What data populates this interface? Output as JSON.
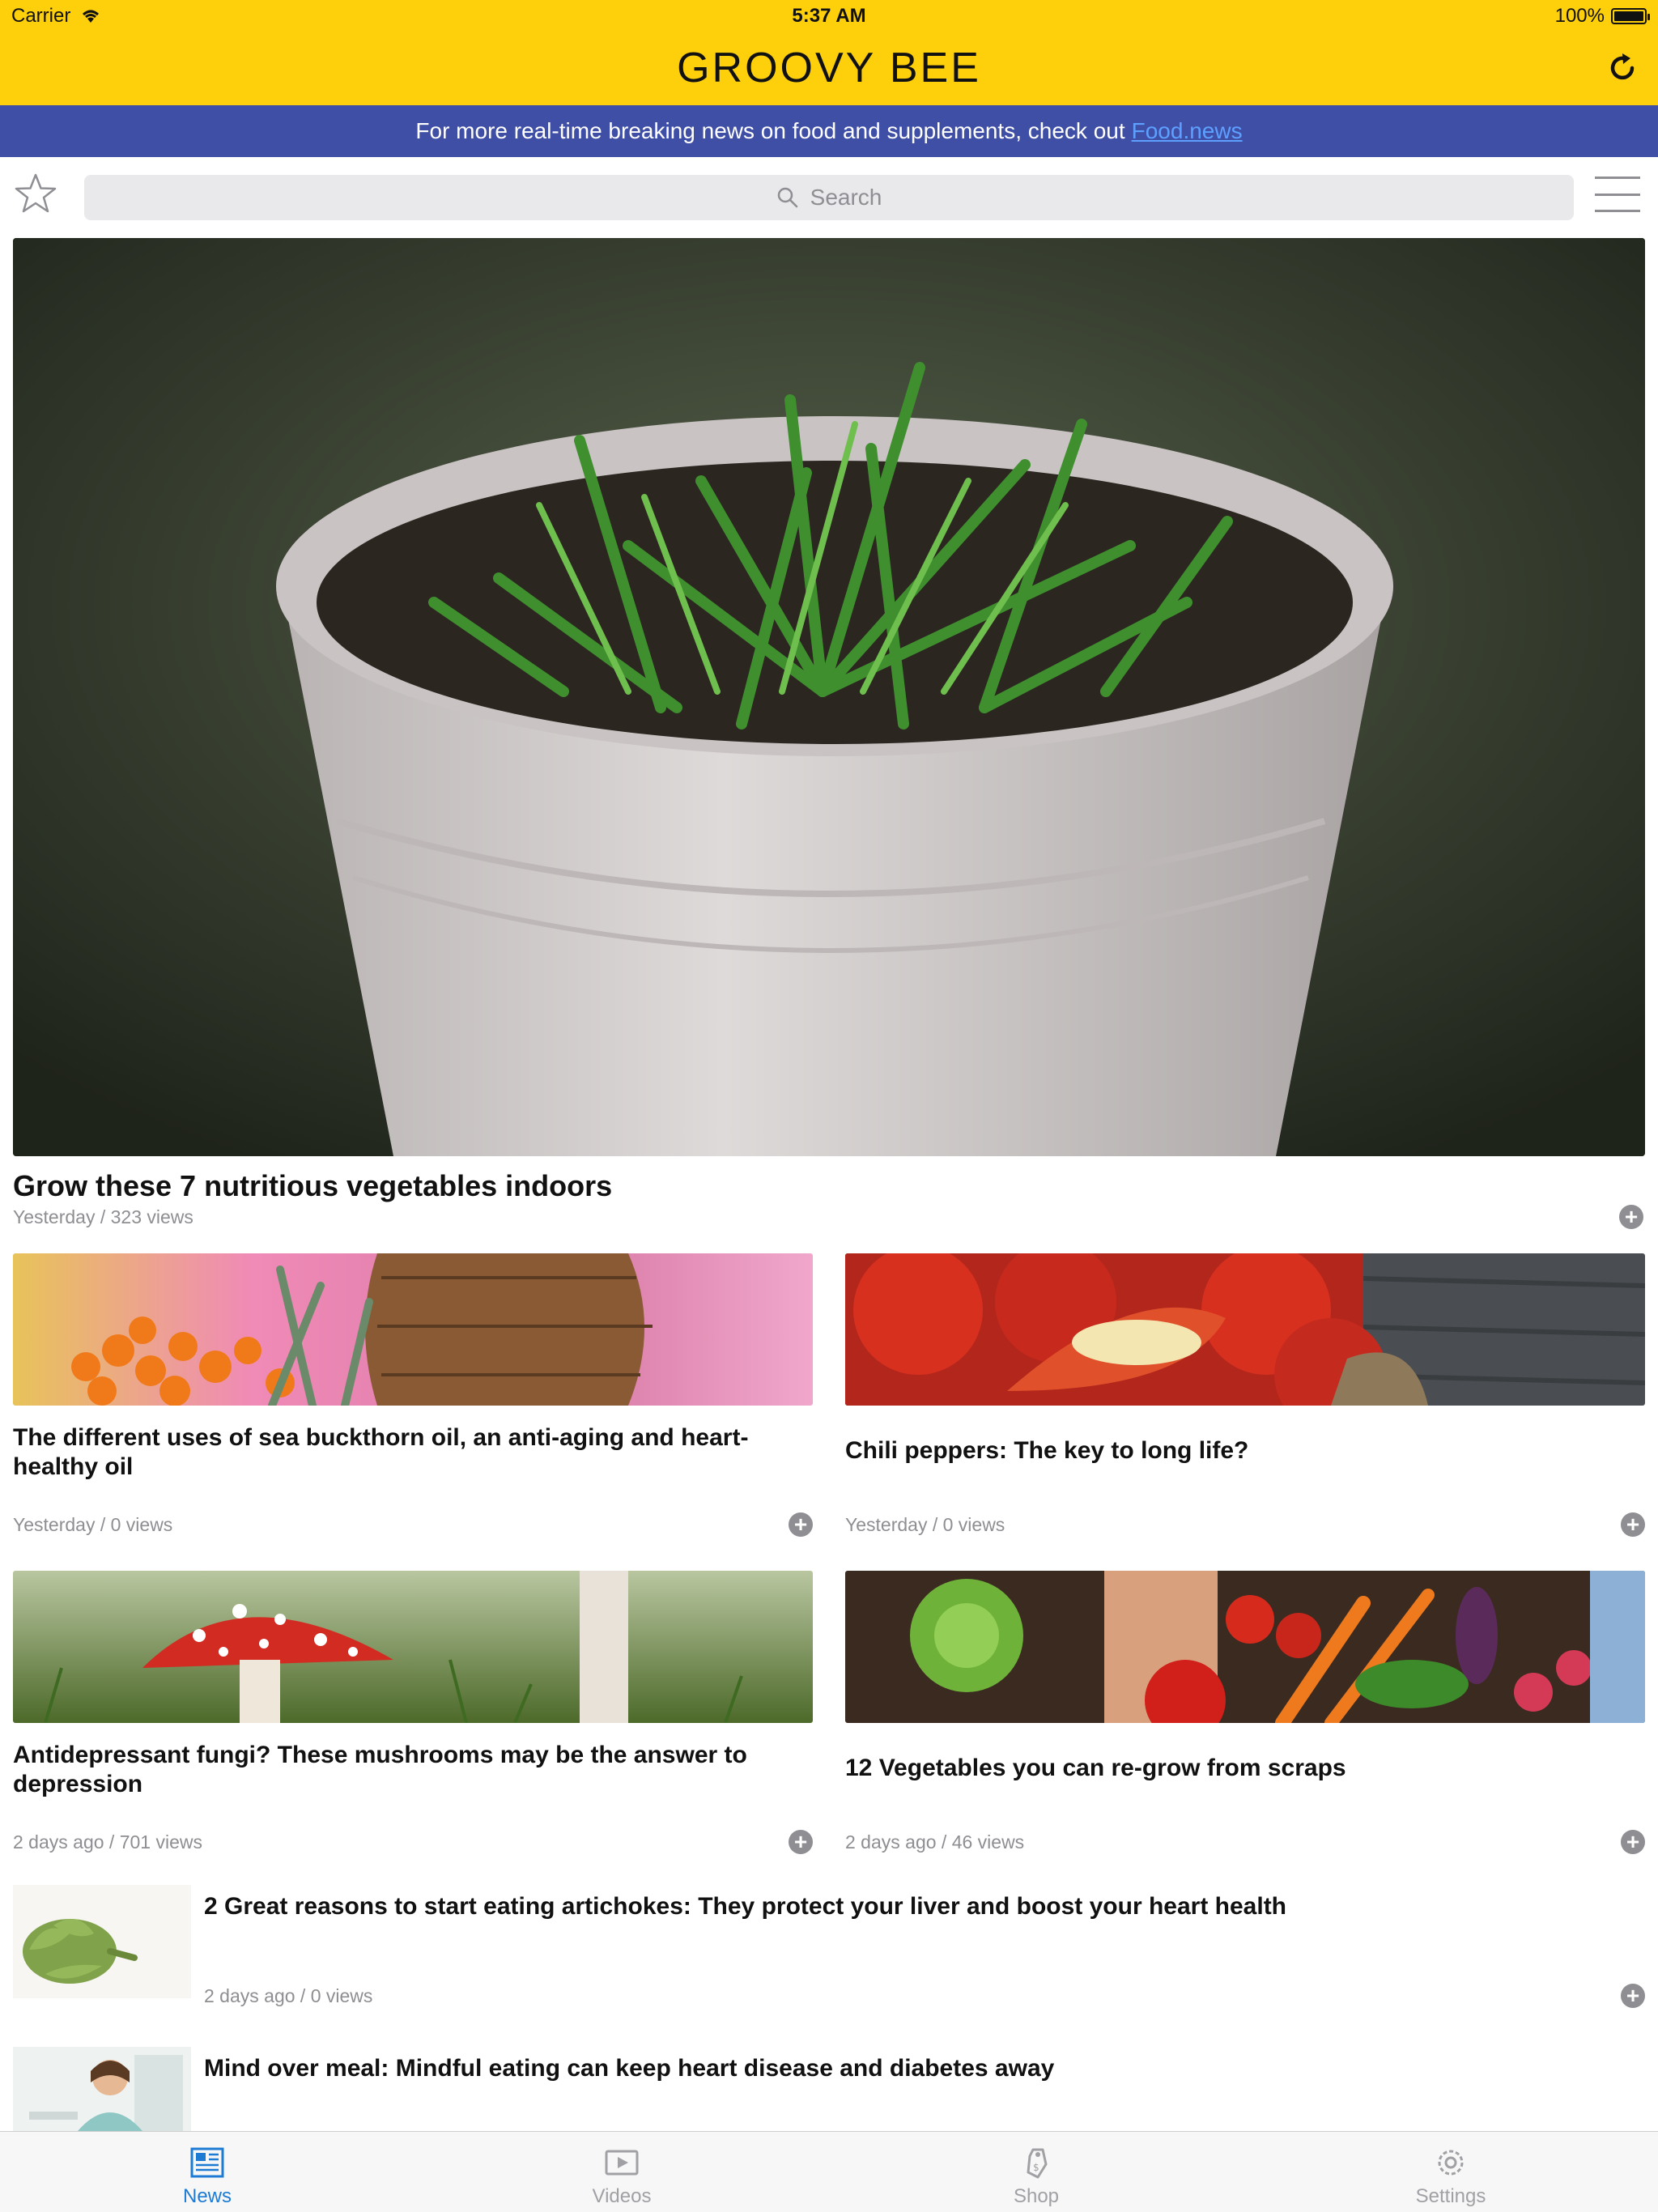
{
  "status_bar": {
    "carrier": "Carrier",
    "time": "5:37 AM",
    "battery": "100%"
  },
  "header": {
    "title": "GROOVY BEE",
    "refresh_icon": "refresh-icon",
    "background": "#fecf0b"
  },
  "banner": {
    "text": "For more real-time breaking news on food and supplements, check out",
    "link_text": "Food.news",
    "background": "#3f4fa6"
  },
  "search": {
    "placeholder": "Search",
    "favorites_icon": "star-icon",
    "menu_icon": "hamburger-menu-icon"
  },
  "hero": {
    "title": "Grow these 7 nutritious vegetables indoors",
    "meta": "Yesterday / 323 views"
  },
  "cards": [
    {
      "title": "The different uses of sea buckthorn oil, an anti-aging and heart-healthy oil",
      "meta": "Yesterday / 0 views"
    },
    {
      "title": "Chili peppers: The key to long life?",
      "meta": "Yesterday / 0 views"
    },
    {
      "title": "Antidepressant fungi? These mushrooms may be the answer to depression",
      "meta": "2 days ago / 701 views"
    },
    {
      "title": "12 Vegetables you can re-grow from scraps",
      "meta": "2 days ago / 46 views"
    }
  ],
  "list": [
    {
      "title": "2 Great reasons to start eating artichokes: They protect your liver and boost your heart health",
      "meta": "2 days ago / 0 views"
    },
    {
      "title": "Mind over meal: Mindful eating can keep heart disease and diabetes away",
      "meta": ""
    }
  ],
  "add_label": "+",
  "tabs": [
    {
      "label": "News",
      "icon": "newspaper-icon",
      "active": true
    },
    {
      "label": "Videos",
      "icon": "play-video-icon",
      "active": false
    },
    {
      "label": "Shop",
      "icon": "price-tag-icon",
      "active": false
    },
    {
      "label": "Settings",
      "icon": "gear-icon",
      "active": false
    }
  ],
  "colors": {
    "accent": "#1e7bd4",
    "inactive": "#a0a0a5",
    "meta": "#8e8e93",
    "link": "#5ea0ff"
  }
}
